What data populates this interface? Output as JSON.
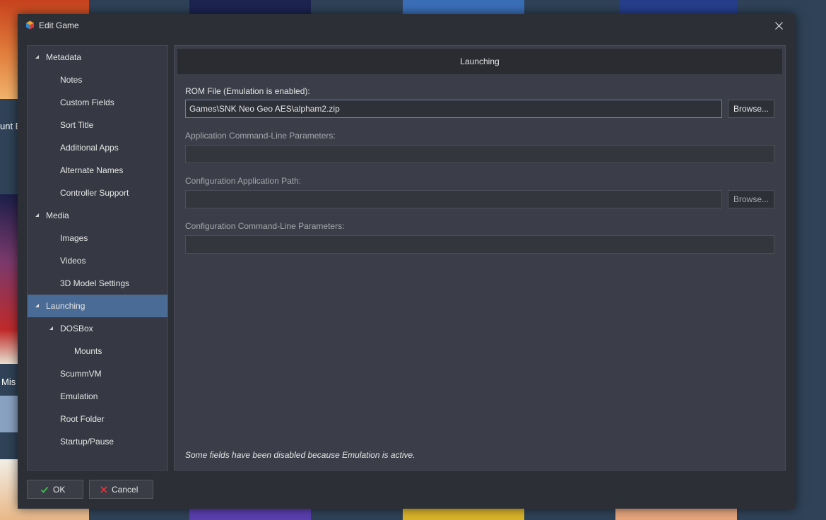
{
  "background": {
    "visible_text": [
      "unt B",
      "Mis"
    ]
  },
  "dialog": {
    "title": "Edit Game"
  },
  "sidebar": {
    "items": [
      {
        "label": "Metadata",
        "expanded": true
      },
      {
        "label": "Notes"
      },
      {
        "label": "Custom Fields"
      },
      {
        "label": "Sort Title"
      },
      {
        "label": "Additional Apps"
      },
      {
        "label": "Alternate Names"
      },
      {
        "label": "Controller Support"
      },
      {
        "label": "Media",
        "expanded": true
      },
      {
        "label": "Images"
      },
      {
        "label": "Videos"
      },
      {
        "label": "3D Model Settings"
      },
      {
        "label": "Launching",
        "expanded": true,
        "selected": true
      },
      {
        "label": "DOSBox",
        "expanded": true
      },
      {
        "label": "Mounts"
      },
      {
        "label": "ScummVM"
      },
      {
        "label": "Emulation"
      },
      {
        "label": "Root Folder"
      },
      {
        "label": "Startup/Pause"
      }
    ]
  },
  "panel": {
    "header": "Launching",
    "fields": [
      {
        "label": "ROM File (Emulation is enabled):",
        "value": "Games\\SNK Neo Geo AES\\alpham2.zip",
        "enabled": true,
        "browse": "Browse..."
      },
      {
        "label": "Application Command-Line Parameters:",
        "value": "",
        "enabled": false
      },
      {
        "label": "Configuration Application Path:",
        "value": "",
        "enabled": false,
        "browse": "Browse..."
      },
      {
        "label": "Configuration Command-Line Parameters:",
        "value": "",
        "enabled": false
      }
    ],
    "note": "Some fields have been disabled because Emulation is active."
  },
  "buttons": {
    "ok": "OK",
    "cancel": "Cancel"
  },
  "colors": {
    "selection": "#4a6b96",
    "ok_check": "#3fbf4f",
    "cancel_x": "#e0343a"
  },
  "icons": {
    "app": "launchbox-icon",
    "close": "close-icon",
    "expand": "triangle-expanded-icon",
    "ok": "checkmark-icon",
    "cancel": "x-icon"
  }
}
